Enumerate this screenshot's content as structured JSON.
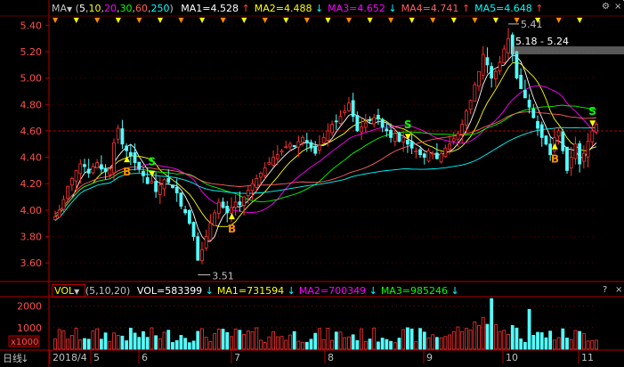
{
  "main_panel": {
    "indicator": "MA",
    "params_open": "(",
    "params": [
      {
        "text": "5",
        "color": "#ffffff"
      },
      {
        "text": "10",
        "color": "#ffff00"
      },
      {
        "text": "20",
        "color": "#ff00ff"
      },
      {
        "text": "30",
        "color": "#00ff00"
      },
      {
        "text": "60",
        "color": "#ff6060"
      },
      {
        "text": "250",
        "color": "#00ffff"
      }
    ],
    "params_close": ")",
    "readouts": [
      {
        "label": "MA1=4.528",
        "arrow": "↑",
        "color": "#ffffff",
        "arrow_color": "#ff4040"
      },
      {
        "label": "MA2=4.488",
        "arrow": "↓",
        "color": "#ffff00",
        "arrow_color": "#00ffff"
      },
      {
        "label": "MA3=4.652",
        "arrow": "↓",
        "color": "#ff00ff",
        "arrow_color": "#00ffff"
      },
      {
        "label": "MA4=4.741",
        "arrow": "↑",
        "color": "#ff6060",
        "arrow_color": "#ff4040"
      },
      {
        "label": "MA5=4.648",
        "arrow": "↑",
        "color": "#00ffff",
        "arrow_color": "#ff4040"
      }
    ],
    "y_ticks": [
      "5.40",
      "5.20",
      "5.00",
      "4.80",
      "4.60",
      "4.40",
      "4.20",
      "4.00",
      "3.80",
      "3.60"
    ],
    "annotations": {
      "high": "5.41",
      "low": "3.51",
      "range_label": "5.18 - 5.24"
    },
    "corner_buttons": {
      "settings": "⚙",
      "close": "×"
    }
  },
  "volume_panel": {
    "indicator": "VOL",
    "params": "(5,10,20)",
    "readouts": [
      {
        "label": "VOL=583399",
        "arrow": "↓",
        "color": "#ffffff"
      },
      {
        "label": "MA1=731594",
        "arrow": "↓",
        "color": "#ffff00"
      },
      {
        "label": "MA2=700349",
        "arrow": "↓",
        "color": "#ff00ff"
      },
      {
        "label": "MA3=985246",
        "arrow": "↓",
        "color": "#00ff00"
      }
    ],
    "y_ticks": [
      "2000",
      "1000"
    ],
    "unit": "x1000",
    "corner_buttons": {
      "help": "?",
      "close": "×"
    }
  },
  "footer": {
    "period": "日线",
    "x_labels": [
      "2018/4",
      "5",
      "6",
      "7",
      "8",
      "9",
      "10",
      "11"
    ]
  },
  "colors": {
    "up": "#ff3232",
    "down": "#54fcfc",
    "grid": "#8b0000",
    "axis": "#b00000",
    "ma5": "#ffffff",
    "ma10": "#ffff00",
    "ma20": "#ff00ff",
    "ma30": "#00ff00",
    "ma60": "#ff6060",
    "ma250": "#00ffff",
    "buy_signal": "#ff8c00",
    "sell_signal": "#00ff00"
  },
  "chart_data": {
    "type": "candlestick",
    "price_range": [
      3.5,
      5.47
    ],
    "volume_range_x1000": [
      0,
      2400
    ],
    "closes": [
      3.95,
      4.0,
      4.08,
      4.18,
      4.24,
      4.3,
      4.35,
      4.33,
      4.28,
      4.33,
      4.36,
      4.31,
      4.29,
      4.31,
      4.51,
      4.62,
      4.5,
      4.45,
      4.41,
      4.36,
      4.31,
      4.26,
      4.2,
      4.22,
      4.14,
      4.19,
      4.23,
      4.21,
      4.17,
      4.13,
      4.03,
      3.98,
      3.9,
      3.8,
      3.62,
      3.7,
      3.8,
      3.9,
      3.98,
      4.06,
      4.02,
      3.98,
      4.02,
      4.06,
      4.04,
      4.1,
      4.15,
      4.2,
      4.24,
      4.28,
      4.32,
      4.36,
      4.4,
      4.42,
      4.45,
      4.48,
      4.5,
      4.48,
      4.52,
      4.55,
      4.51,
      4.47,
      4.43,
      4.49,
      4.55,
      4.6,
      4.65,
      4.67,
      4.71,
      4.75,
      4.81,
      4.71,
      4.6,
      4.63,
      4.66,
      4.68,
      4.7,
      4.69,
      4.63,
      4.6,
      4.55,
      4.58,
      4.52,
      4.55,
      4.5,
      4.47,
      4.45,
      4.42,
      4.4,
      4.45,
      4.43,
      4.39,
      4.43,
      4.47,
      4.5,
      4.54,
      4.58,
      4.65,
      4.75,
      4.83,
      4.95,
      5.05,
      5.18,
      5.1,
      5.0,
      5.05,
      5.12,
      5.22,
      5.3,
      5.18,
      5.0,
      4.92,
      4.85,
      4.78,
      4.7,
      4.62,
      4.55,
      4.5,
      4.42,
      4.55,
      4.6,
      4.45,
      4.3,
      4.4,
      4.5,
      4.35,
      4.43,
      4.52,
      4.6,
      4.65
    ],
    "ma_lines": [
      "MA5",
      "MA10",
      "MA20",
      "MA30",
      "MA60",
      "MA250"
    ],
    "signals": [
      {
        "type": "B",
        "bar": 17
      },
      {
        "type": "S",
        "bar": 23
      },
      {
        "type": "B",
        "bar": 42
      },
      {
        "type": "S",
        "bar": 84
      },
      {
        "type": "B",
        "bar": 119
      },
      {
        "type": "S",
        "bar": 128
      },
      {
        "type": "B",
        "bar": 136
      },
      {
        "type": "S",
        "bar": 140
      }
    ]
  }
}
